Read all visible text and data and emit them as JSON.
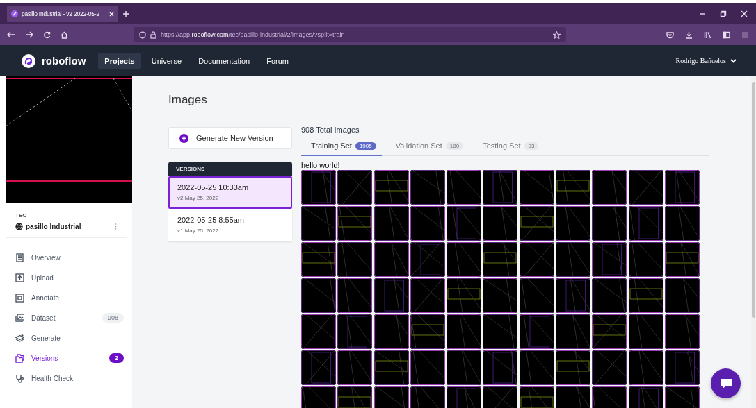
{
  "browser": {
    "tab_title": "pasillo Industrial - v2 2022-05-2",
    "url": "https://app.**roboflow.com**/tec/pasillo-industrial/2/images/?split=train"
  },
  "nav": {
    "brand": "roboflow",
    "links": [
      {
        "label": "Projects",
        "selected": true
      },
      {
        "label": "Universe",
        "selected": false
      },
      {
        "label": "Documentation",
        "selected": false
      },
      {
        "label": "Forum",
        "selected": false
      }
    ],
    "user": "Rodrigo Bañuelos"
  },
  "sidebar": {
    "workspace": "TEC",
    "project": "pasillo Industrial",
    "items": [
      {
        "label": "Overview",
        "kind": "overview",
        "selected": false
      },
      {
        "label": "Upload",
        "kind": "upload",
        "selected": false
      },
      {
        "label": "Annotate",
        "kind": "annotate",
        "selected": false
      },
      {
        "label": "Dataset",
        "kind": "dataset",
        "selected": false,
        "badge": "908"
      },
      {
        "label": "Generate",
        "kind": "generate",
        "selected": false
      },
      {
        "label": "Versions",
        "kind": "versions",
        "selected": true,
        "badge": "2"
      },
      {
        "label": "Health Check",
        "kind": "health",
        "selected": false
      }
    ]
  },
  "main": {
    "title": "Images",
    "generate_button": "Generate New Version",
    "versions": {
      "header": "VERSIONS",
      "items": [
        {
          "name": "2022-05-25 10:33am",
          "meta": "v2 May 25, 2022",
          "selected": true
        },
        {
          "name": "2022-05-25 8:55am",
          "meta": "v1 May 25, 2022",
          "selected": false
        }
      ]
    },
    "total": "908 Total Images",
    "tabs": [
      {
        "label": "Training Set",
        "count": "1905",
        "selected": true
      },
      {
        "label": "Validation Set",
        "count": "180",
        "selected": false
      },
      {
        "label": "Testing Set",
        "count": "93",
        "selected": false
      }
    ],
    "caption": "hello world!"
  }
}
